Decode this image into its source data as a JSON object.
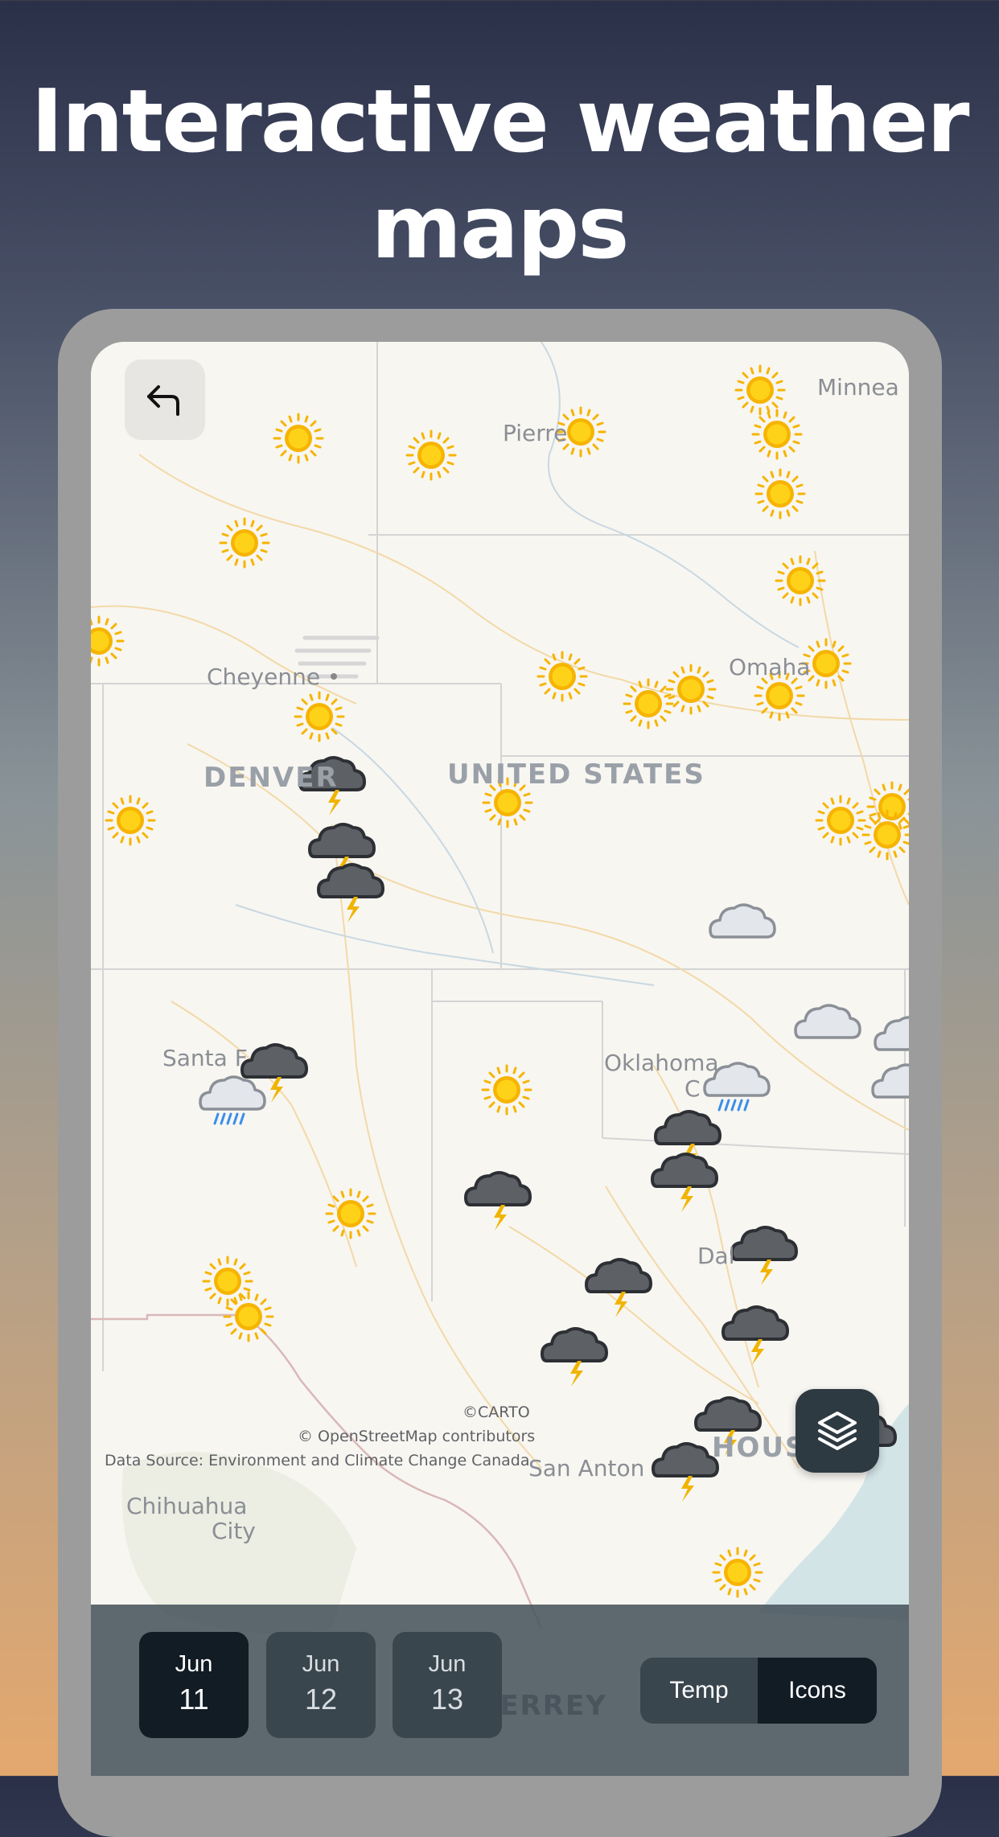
{
  "headline": {
    "line1": "Interactive weather",
    "line2": "maps"
  },
  "map": {
    "cities": {
      "minneapolis": "Minnea",
      "pierre": "Pierre",
      "cheyenne": "Cheyenne",
      "omaha": "Omaha",
      "denver": "DENVER",
      "united_states": "UNITED STATES",
      "santa_fe": "Santa F",
      "oklahoma": "Oklahoma",
      "oklahoma_2": "C",
      "dallas": "Dal",
      "houston": "HOUS",
      "san_antonio": "San Anton",
      "chihuahua": "Chihuahua",
      "chihuahua_2": "City",
      "monterrey": "MONTERREY"
    },
    "attribution": {
      "carto": "©CARTO",
      "osm": "© OpenStreetMap contributors",
      "source": "Data Source: Environment and Climate Change Canada"
    },
    "icon_types": [
      "sun-icon",
      "thunderstorm-icon",
      "cloud-icon",
      "rain-cloud-icon"
    ]
  },
  "controls": {
    "back_icon": "back-arrow-icon",
    "layers_icon": "layers-icon",
    "dates": [
      {
        "month": "Jun",
        "day": "11",
        "active": true
      },
      {
        "month": "Jun",
        "day": "12",
        "active": false
      },
      {
        "month": "Jun",
        "day": "13",
        "active": false
      }
    ],
    "toggle": {
      "temp": "Temp",
      "icons": "Icons",
      "selected": "Icons"
    }
  }
}
